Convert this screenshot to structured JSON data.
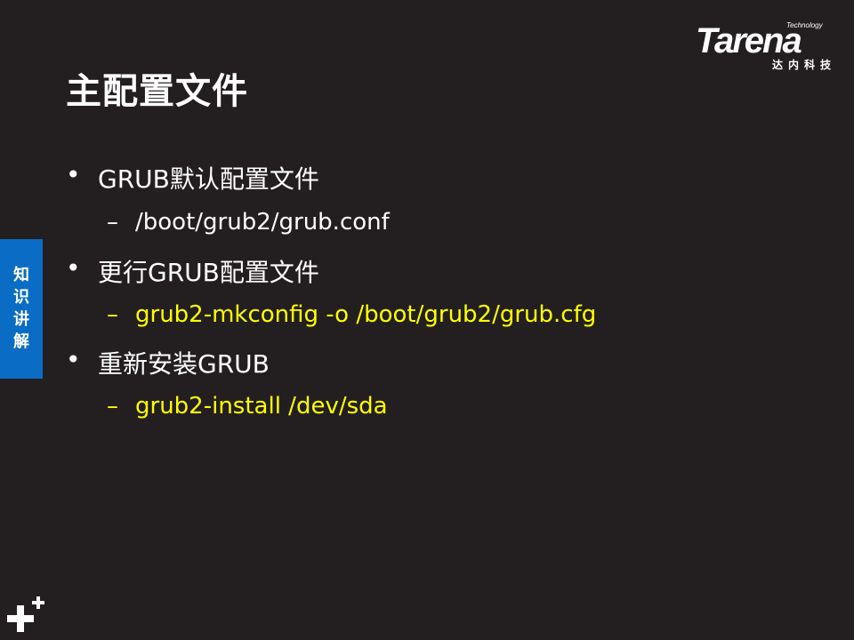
{
  "slide": {
    "title": "主配置文件",
    "logo": {
      "technology": "Technology",
      "brand": "Tarena",
      "chinese": "达内科技"
    },
    "side_tab": {
      "label": "知识讲解"
    },
    "items": [
      {
        "bullet": "•",
        "text": "GRUB默认配置文件",
        "sub": {
          "dash": "–",
          "text": "/boot/grub2/grub.conf",
          "color": "#ffffff"
        }
      },
      {
        "bullet": "•",
        "text": "更行GRUB配置文件",
        "sub": {
          "dash": "–",
          "text": "grub2-mkconfig -o /boot/grub2/grub.cfg",
          "color": "#ffff00"
        }
      },
      {
        "bullet": "•",
        "text": "重新安装GRUB",
        "sub": {
          "dash": "–",
          "text": "grub2-install  /dev/sda",
          "color": "#ffff00"
        }
      }
    ],
    "colors": {
      "background": "#231f20",
      "accent_blue": "#0a6cc4",
      "highlight_yellow": "#ffff00",
      "text_white": "#ffffff"
    },
    "decor_icon": "plus-plus-icon"
  }
}
